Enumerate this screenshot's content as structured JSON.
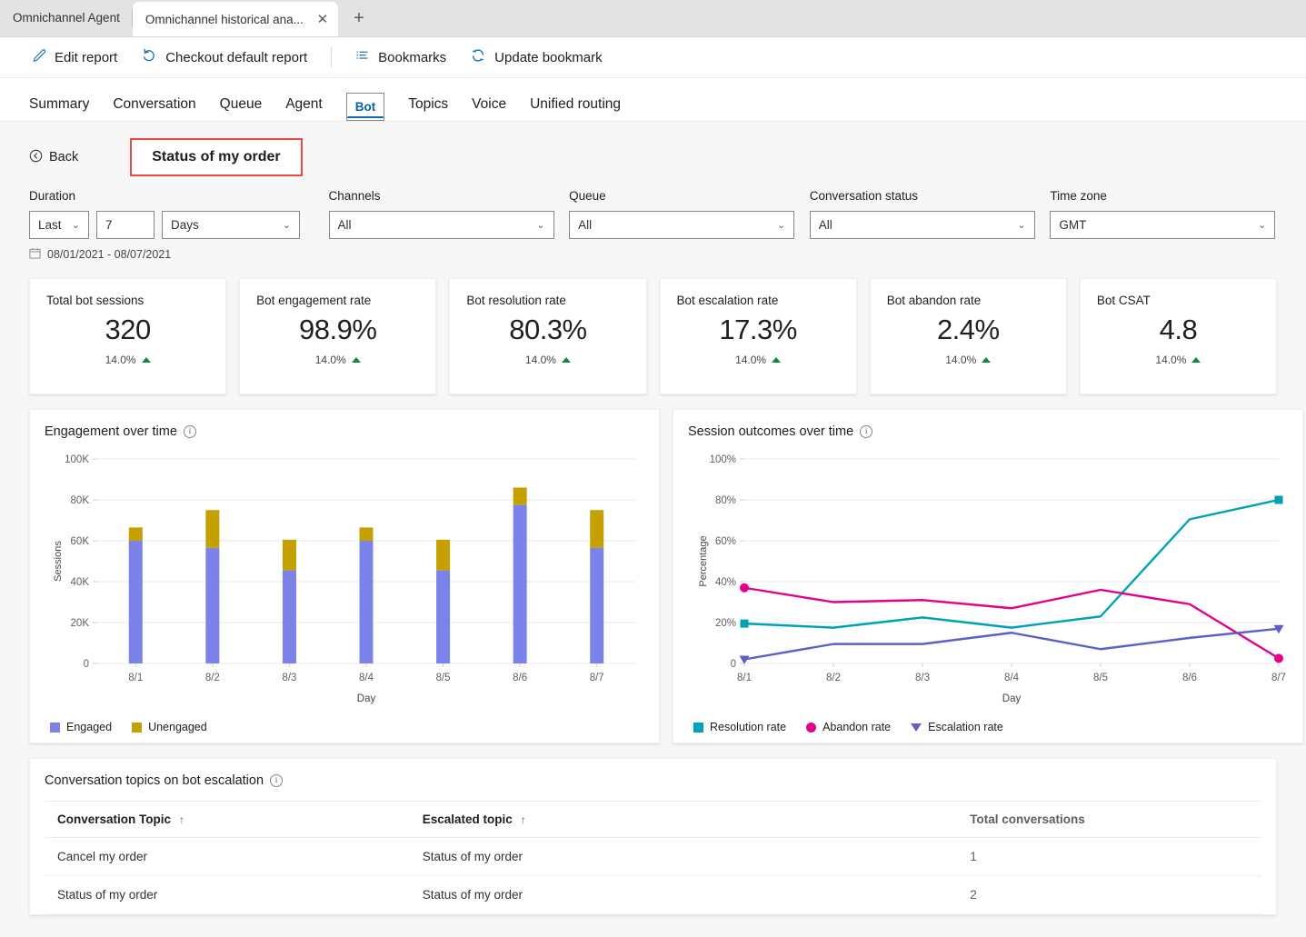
{
  "browser": {
    "tabs": [
      {
        "title": "Omnichannel Agent",
        "active": false
      },
      {
        "title": "Omnichannel historical ana...",
        "active": true
      }
    ],
    "close_glyph": "✕",
    "newtab_glyph": "+"
  },
  "command_bar": {
    "items": [
      {
        "label": "Edit report",
        "icon": "pencil-icon"
      },
      {
        "label": "Checkout default report",
        "icon": "undo-arrow-icon"
      },
      {
        "label": "Bookmarks",
        "icon": "bookmark-list-icon"
      },
      {
        "label": "Update bookmark",
        "icon": "refresh-icon"
      }
    ]
  },
  "pivot_nav": {
    "items": [
      {
        "label": "Summary",
        "selected": false
      },
      {
        "label": "Conversation",
        "selected": false
      },
      {
        "label": "Queue",
        "selected": false
      },
      {
        "label": "Agent",
        "selected": false
      },
      {
        "label": "Bot",
        "selected": true
      },
      {
        "label": "Topics",
        "selected": false
      },
      {
        "label": "Voice",
        "selected": false
      },
      {
        "label": "Unified routing",
        "selected": false
      }
    ]
  },
  "header": {
    "back_label": "Back",
    "back_icon": "back-circle-arrow-icon",
    "page_title": "Status of my order",
    "highlight_color": "#f0483e"
  },
  "filters": {
    "duration": {
      "label": "Duration",
      "relative_value": "Last",
      "amount_value": "7",
      "unit_value": "Days"
    },
    "channels": {
      "label": "Channels",
      "value": "All"
    },
    "queue": {
      "label": "Queue",
      "value": "All"
    },
    "conversation_status": {
      "label": "Conversation status",
      "value": "All"
    },
    "time_zone": {
      "label": "Time zone",
      "value": "GMT"
    },
    "date_range": "08/01/2021 - 08/07/2021",
    "date_range_icon": "calendar-icon",
    "chevron_glyph": "⌄"
  },
  "kpis": [
    {
      "title": "Total bot sessions",
      "value": "320",
      "delta": "14.0%",
      "trend": "up"
    },
    {
      "title": "Bot engagement rate",
      "value": "98.9%",
      "delta": "14.0%",
      "trend": "up"
    },
    {
      "title": "Bot resolution rate",
      "value": "80.3%",
      "delta": "14.0%",
      "trend": "up"
    },
    {
      "title": "Bot escalation rate",
      "value": "17.3%",
      "delta": "14.0%",
      "trend": "up"
    },
    {
      "title": "Bot abandon rate",
      "value": "2.4%",
      "delta": "14.0%",
      "trend": "up"
    },
    {
      "title": "Bot CSAT",
      "value": "4.8",
      "delta": "14.0%",
      "trend": "up"
    }
  ],
  "chart_data": [
    {
      "type": "bar",
      "stacked": true,
      "title": "Engagement over time",
      "xlabel": "Day",
      "ylabel": "Sessions",
      "categories": [
        "8/1",
        "8/2",
        "8/3",
        "8/4",
        "8/5",
        "8/6",
        "8/7"
      ],
      "ytick_labels": [
        "0",
        "20K",
        "40K",
        "60K",
        "80K",
        "100K"
      ],
      "ytick_values": [
        0,
        20000,
        40000,
        60000,
        80000,
        100000
      ],
      "ylim": [
        0,
        100000
      ],
      "grid": true,
      "legend_position": "bottom-left",
      "series": [
        {
          "name": "Engaged",
          "color": "#7B83EB",
          "values": [
            60000,
            56500,
            45500,
            60000,
            45500,
            77500,
            56500
          ]
        },
        {
          "name": "Unengaged",
          "color": "#C4A000",
          "values": [
            6500,
            18500,
            15000,
            6500,
            15000,
            8500,
            18500
          ]
        }
      ]
    },
    {
      "type": "line",
      "title": "Session outcomes over time",
      "xlabel": "Day",
      "ylabel": "Percentage",
      "categories": [
        "8/1",
        "8/2",
        "8/3",
        "8/4",
        "8/5",
        "8/6",
        "8/7"
      ],
      "ytick_labels": [
        "0",
        "20%",
        "40%",
        "60%",
        "80%",
        "100%"
      ],
      "ytick_values": [
        0,
        20,
        40,
        60,
        80,
        100
      ],
      "ylim": [
        0,
        100
      ],
      "grid": true,
      "legend_position": "bottom-left",
      "series": [
        {
          "name": "Resolution rate",
          "color": "#00A2B5",
          "marker": "square",
          "values": [
            19.5,
            17.5,
            22.5,
            17.5,
            23.0,
            70.5,
            80.0
          ]
        },
        {
          "name": "Abandon rate",
          "color": "#E3008C",
          "marker": "circle",
          "values": [
            37.0,
            30.0,
            31.0,
            27.0,
            36.0,
            29.0,
            2.5
          ]
        },
        {
          "name": "Escalation rate",
          "color": "#5B5FC7",
          "marker": "triangle-down",
          "values": [
            2.0,
            9.5,
            9.5,
            15.0,
            7.0,
            12.5,
            17.0
          ]
        }
      ]
    }
  ],
  "table": {
    "title": "Conversation topics on bot escalation",
    "columns": [
      {
        "label": "Conversation Topic",
        "sort": "↑"
      },
      {
        "label": "Escalated topic",
        "sort": "↑"
      },
      {
        "label": "Total conversations",
        "sort": ""
      }
    ],
    "rows": [
      {
        "topic": "Cancel my order",
        "escalated": "Status of my order",
        "total": "1"
      },
      {
        "topic": "Status of my order",
        "escalated": "Status of my order",
        "total": "2"
      }
    ]
  }
}
